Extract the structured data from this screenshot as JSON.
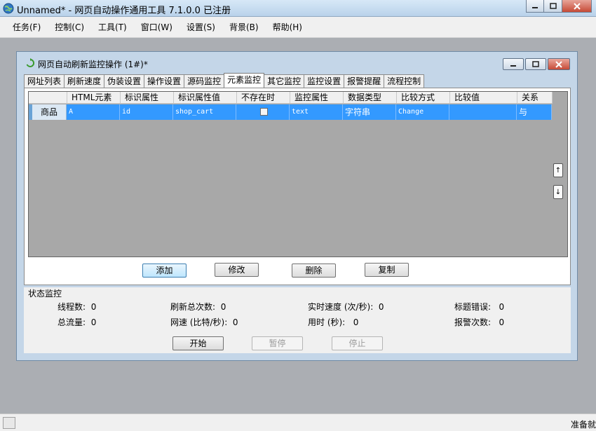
{
  "window": {
    "title": "Unnamed* - 网页自动操作通用工具 7.1.0.0  已注册"
  },
  "menu": [
    "任务(F)",
    "控制(C)",
    "工具(T)",
    "窗口(W)",
    "设置(S)",
    "背景(B)",
    "帮助(H)"
  ],
  "child": {
    "title": "网页自动刷新监控操作  (1#)*",
    "tabs": [
      "网址列表",
      "刷新速度",
      "伪装设置",
      "操作设置",
      "源码监控",
      "元素监控",
      "其它监控",
      "监控设置",
      "报警提醒",
      "流程控制"
    ],
    "active_tab": "元素监控"
  },
  "grid": {
    "columns": [
      "HTML元素",
      "标识属性",
      "标识属性值",
      "不存在时",
      "监控属性",
      "数据类型",
      "比较方式",
      "比较值",
      "关系"
    ],
    "rows": [
      {
        "header": "商品",
        "cells": [
          "A",
          "id",
          "shop_cart",
          "",
          "text",
          "字符串",
          "Change",
          "",
          "与"
        ],
        "not_exist_checked": false
      }
    ],
    "up_arrow": "↑",
    "down_arrow": "↓"
  },
  "buttons": {
    "add": "添加",
    "modify": "修改",
    "delete": "删除",
    "copy": "复制"
  },
  "status": {
    "legend": "状态监控",
    "threads_label": "线程数:",
    "threads": "0",
    "refresh_total_label": "刷新总次数:",
    "refresh_total": "0",
    "realtime_speed_label": "实时速度 (次/秒):",
    "realtime_speed": "0",
    "title_errors_label": "标题错误:",
    "title_errors": "0",
    "total_traffic_label": "总流量:",
    "total_traffic": "0",
    "net_speed_label": "网速 (比特/秒):",
    "net_speed": "0",
    "elapsed_label": "用时 (秒):",
    "elapsed": "0",
    "alarm_count_label": "报警次数:",
    "alarm_count": "0"
  },
  "controls": {
    "start": "开始",
    "pause": "暂停",
    "stop": "停止"
  },
  "statusbar": {
    "ready": "准备就"
  }
}
